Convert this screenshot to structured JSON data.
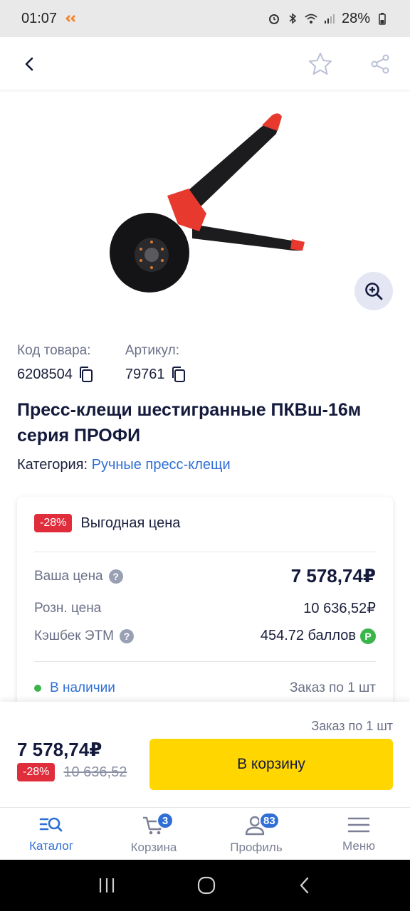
{
  "status_bar": {
    "time": "01:07",
    "battery": "28%"
  },
  "product": {
    "code_label": "Код товара:",
    "code_value": "6208504",
    "article_label": "Артикул:",
    "article_value": "79761",
    "title": "Пресс-клещи шестигранные ПКВш-16м серия ПРОФИ",
    "category_label": "Категория:",
    "category_link": "Ручные пресс-клещи"
  },
  "price_card": {
    "discount_badge": "-28%",
    "deal_text": "Выгодная цена",
    "your_price_label": "Ваша цена",
    "your_price": "7 578,74₽",
    "retail_label": "Розн. цена",
    "retail_price": "10 636,52₽",
    "cashback_label": "Кэшбек ЭТМ",
    "cashback_value": "454.72 баллов",
    "availability": "В наличии",
    "order_min": "Заказ по 1 шт"
  },
  "buy_panel": {
    "order_min": "Заказ по 1 шт",
    "current_price": "7 578,74₽",
    "discount_badge": "-28%",
    "old_price": "10 636,52",
    "cart_button": "В корзину"
  },
  "bottom_nav": {
    "items": [
      {
        "label": "Каталог",
        "icon": "catalog-search-icon"
      },
      {
        "label": "Корзина",
        "icon": "cart-icon",
        "badge": "3"
      },
      {
        "label": "Профиль",
        "icon": "profile-icon",
        "badge": "83"
      },
      {
        "label": "Меню",
        "icon": "hamburger-icon"
      }
    ]
  },
  "colors": {
    "accent_blue": "#2f6fd6",
    "cart_yellow": "#ffd600",
    "discount_red": "#e02d3c",
    "title_navy": "#141a3c"
  }
}
